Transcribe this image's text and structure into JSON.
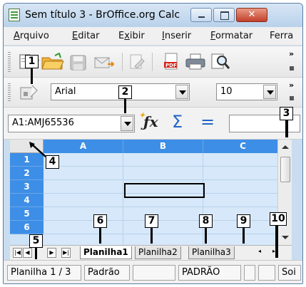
{
  "window": {
    "title": "Sem título 3 - BrOffice.org Calc",
    "close_glyph": "✕"
  },
  "menu": [
    {
      "label": "Arquivo",
      "accel": "A",
      "rest": "rquivo"
    },
    {
      "label": "Editar",
      "accel": "E",
      "rest": "ditar"
    },
    {
      "label": "Exibir",
      "accel": "x",
      "pre": "E",
      "rest": "ibir"
    },
    {
      "label": "Inserir",
      "accel": "I",
      "rest": "nserir"
    },
    {
      "label": "Formatar",
      "accel": "F",
      "rest": "ormatar"
    },
    {
      "label": "Ferra",
      "accel": "",
      "rest": "Ferra"
    }
  ],
  "format_bar": {
    "font_name": "Arial",
    "font_size": "10"
  },
  "formula_bar": {
    "name_box": "A1:AMJ65536",
    "function_wizard_icon": "fx-icon",
    "sum_glyph": "Σ",
    "equals_glyph": "=",
    "input_value": ""
  },
  "grid": {
    "columns": [
      "A",
      "B",
      "C"
    ],
    "rows": [
      "1",
      "2",
      "3",
      "4",
      "5",
      "6"
    ],
    "active_cell": "B3"
  },
  "sheets": {
    "tabs": [
      "Planilha1",
      "Planilha2",
      "Planilha3"
    ],
    "active_tab": "Planilha1"
  },
  "status": {
    "sheet_position": "Planilha 1 / 3",
    "page_style": "Padrão",
    "mode": "PADRÃO",
    "sum_label": "Soi"
  },
  "callouts": [
    "1",
    "2",
    "3",
    "4",
    "5",
    "6",
    "7",
    "8",
    "9",
    "10"
  ],
  "colors": {
    "header_blue": "#3d8ee6",
    "selection_fill": "#d6e8f9",
    "close_red": "#c3402a"
  }
}
